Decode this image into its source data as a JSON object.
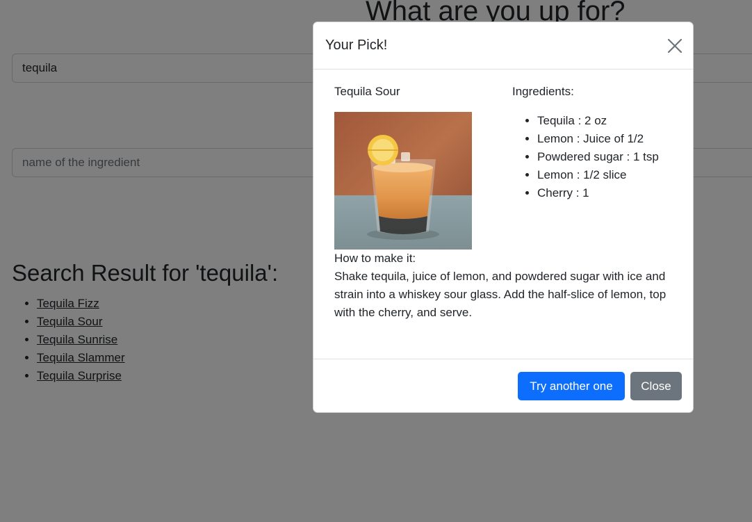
{
  "page": {
    "heading": "What are you up for?",
    "ingredient_input": {
      "value": "tequila",
      "placeholder": ""
    },
    "name_input": {
      "value": "",
      "placeholder": "name of the ingredient"
    },
    "results_heading": "Search Result for 'tequila':",
    "results": [
      "Tequila Fizz",
      "Tequila Sour",
      "Tequila Sunrise",
      "Tequila Slammer",
      "Tequila Surprise"
    ]
  },
  "modal": {
    "title": "Your Pick!",
    "close_icon": "close-icon",
    "drink_name": "Tequila Sour",
    "ingredients_label": "Ingredients:",
    "ingredients": [
      "Tequila : 2 oz",
      "Lemon : Juice of 1/2",
      "Powdered sugar : 1 tsp",
      "Lemon : 1/2 slice",
      "Cherry : 1"
    ],
    "howto_label": "How to make it:",
    "instructions": "Shake tequila, juice of lemon, and powdered sugar with ice and strain into a whiskey sour glass. Add the half-slice of lemon, top with the cherry, and serve.",
    "try_another_label": "Try another one",
    "close_label": "Close"
  },
  "colors": {
    "primary": "#0d6efd",
    "secondary": "#6c757d",
    "backdrop": "rgba(0,0,0,0.5)"
  }
}
